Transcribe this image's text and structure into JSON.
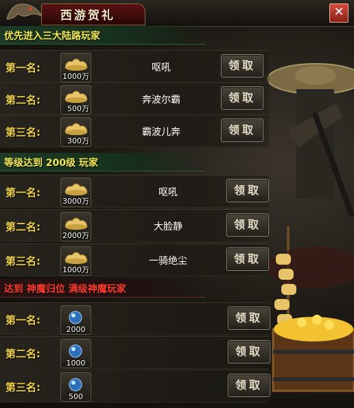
{
  "window": {
    "title": "西游贺礼",
    "close_glyph": "✕"
  },
  "sections": [
    {
      "header": "优先进入三大陆路玩家",
      "rows": [
        {
          "rank": "第一名:",
          "reward_amount": "1000万",
          "player": "呕吼",
          "claim": "领取"
        },
        {
          "rank": "第二名:",
          "reward_amount": "500万",
          "player": "奔波尔霸",
          "claim": "领取"
        },
        {
          "rank": "第三名:",
          "reward_amount": "300万",
          "player": "霸波儿奔",
          "claim": "领取"
        }
      ]
    },
    {
      "header": "等级达到 200级 玩家",
      "rows": [
        {
          "rank": "第一名:",
          "reward_amount": "3000万",
          "player": "呕吼",
          "claim": "领取"
        },
        {
          "rank": "第二名:",
          "reward_amount": "2000万",
          "player": "大脸静",
          "claim": "领取"
        },
        {
          "rank": "第三名:",
          "reward_amount": "1000万",
          "player": "一骑绝尘",
          "claim": "领取"
        }
      ]
    },
    {
      "header": "达到 神魔归位 满级神魔玩家",
      "rows": [
        {
          "rank": "第一名:",
          "reward_amount": "2000",
          "player": "",
          "claim": "领取"
        },
        {
          "rank": "第二名:",
          "reward_amount": "1000",
          "player": "",
          "claim": "领取"
        },
        {
          "rank": "第三名:",
          "reward_amount": "500",
          "player": "",
          "claim": "领取"
        }
      ]
    }
  ],
  "icons": {
    "gold": "gold-ingot-icon",
    "gem": "blue-gem-icon",
    "close": "close-icon"
  },
  "colors": {
    "rank_text": "#f0d24a",
    "section_green_text": "#f3e95a",
    "section_red_text": "#ff3b2e",
    "close_button": "#c0392b"
  }
}
